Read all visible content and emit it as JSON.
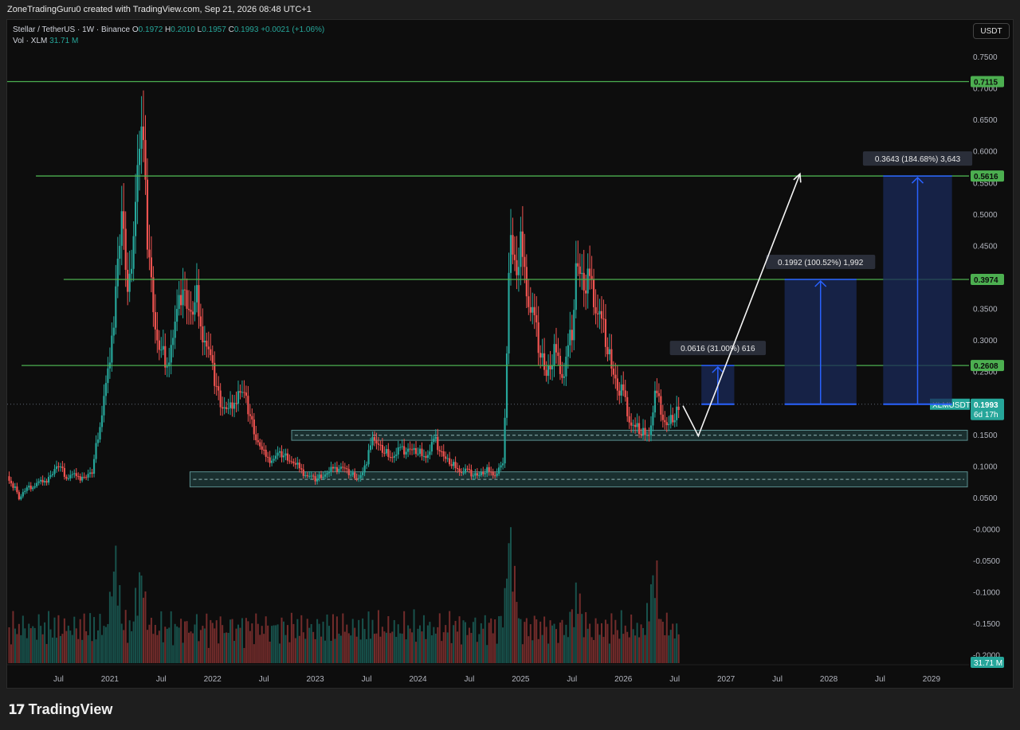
{
  "header": {
    "credit": "ZoneTradingGuru0 created with TradingView.com, Sep 21, 2026 08:48 UTC+1"
  },
  "legend": {
    "symbol": "Stellar / TetherUS · 1W · Binance",
    "open_label": "O",
    "open": "0.1972",
    "high_label": "H",
    "high": "0.2010",
    "low_label": "L",
    "low": "0.1957",
    "close_label": "C",
    "close": "0.1993",
    "change": "+0.0021 (+1.06%)",
    "vol_label": "Vol · XLM",
    "vol_value": "31.71 M"
  },
  "currency_button": "USDT",
  "footer": {
    "brand": "TradingView",
    "brand_icon": "tradingview-logo-icon"
  },
  "colors": {
    "up": "#26a69a",
    "down": "#ef5350",
    "level_line": "#4caf50",
    "level_label_bg": "#4caf50",
    "zone_fill": "#1f3b3b",
    "zone_border": "#5a8f8f",
    "projection_fill": "#1a2a5a",
    "projection_line": "#2962ff",
    "price_label_bg": "#26a69a"
  },
  "chart_data": {
    "type": "candlestick",
    "symbol": "XLMUSDT",
    "interval": "1W",
    "price_axis": {
      "ticks": [
        "0.7500",
        "0.7000",
        "0.6500",
        "0.6000",
        "0.5500",
        "0.5000",
        "0.4500",
        "0.4000",
        "0.3500",
        "0.3000",
        "0.2500",
        "0.2000",
        "0.1500",
        "0.1000",
        "0.0500",
        "-0.0000",
        "-0.0500",
        "-0.1000",
        "-0.1500",
        "-0.2000"
      ],
      "tick_values": [
        0.75,
        0.7,
        0.65,
        0.6,
        0.55,
        0.5,
        0.45,
        0.4,
        0.35,
        0.3,
        0.25,
        0.2,
        0.15,
        0.1,
        0.05,
        0.0,
        -0.05,
        -0.1,
        -0.15,
        -0.2
      ],
      "range": [
        -0.21,
        0.8
      ]
    },
    "time_axis": {
      "labels": [
        "Jul",
        "2021",
        "Jul",
        "2022",
        "Jul",
        "2023",
        "Jul",
        "2024",
        "Jul",
        "2025",
        "Jul",
        "2026",
        "Jul",
        "2027",
        "Jul",
        "2028",
        "Jul",
        "2029"
      ],
      "label_times": [
        2020.5,
        2021.0,
        2021.5,
        2022.0,
        2022.5,
        2023.0,
        2023.5,
        2024.0,
        2024.5,
        2025.0,
        2025.5,
        2026.0,
        2026.5,
        2027.0,
        2027.5,
        2028.0,
        2028.5,
        2029.0
      ],
      "range": [
        2020.0,
        2029.35
      ]
    },
    "horizontal_levels": [
      {
        "price": 0.7115,
        "label": "0.7115"
      },
      {
        "price": 0.5616,
        "label": "0.5616"
      },
      {
        "price": 0.3974,
        "label": "0.3974"
      },
      {
        "price": 0.2608,
        "label": "0.2608"
      }
    ],
    "current_price": {
      "symbol_label": "XLMUSDT",
      "price": 0.1993,
      "label": "0.1993",
      "countdown": "6d 17h"
    },
    "volume_label": "31.71 M",
    "support_zones": [
      {
        "t_start": 2022.77,
        "t_end": 2029.35,
        "top": 0.158,
        "bottom": 0.142
      },
      {
        "t_start": 2021.78,
        "t_end": 2029.35,
        "top": 0.092,
        "bottom": 0.068
      }
    ],
    "projections": [
      {
        "t_start": 2026.76,
        "t_end": 2027.08,
        "base": 0.1993,
        "target": 0.2608,
        "label": "0.0616 (31.00%) 616"
      },
      {
        "t_start": 2027.57,
        "t_end": 2028.27,
        "base": 0.1993,
        "target": 0.3974,
        "label": "0.1992 (100.52%) 1,992"
      },
      {
        "t_start": 2028.53,
        "t_end": 2029.2,
        "base": 0.1993,
        "target": 0.5616,
        "label": "0.3643 (184.68%) 3,643"
      }
    ],
    "path_arrow": [
      {
        "t": 2026.58,
        "p": 0.197
      },
      {
        "t": 2026.73,
        "p": 0.149
      },
      {
        "t": 2027.72,
        "p": 0.565
      }
    ],
    "price_anchors": [
      [
        2020.0,
        0.085
      ],
      [
        2020.08,
        0.065
      ],
      [
        2020.12,
        0.045
      ],
      [
        2020.17,
        0.062
      ],
      [
        2020.25,
        0.07
      ],
      [
        2020.33,
        0.075
      ],
      [
        2020.42,
        0.082
      ],
      [
        2020.5,
        0.1
      ],
      [
        2020.58,
        0.085
      ],
      [
        2020.67,
        0.085
      ],
      [
        2020.75,
        0.08
      ],
      [
        2020.83,
        0.09
      ],
      [
        2020.9,
        0.17
      ],
      [
        2021.0,
        0.26
      ],
      [
        2021.08,
        0.42
      ],
      [
        2021.12,
        0.5
      ],
      [
        2021.18,
        0.35
      ],
      [
        2021.25,
        0.55
      ],
      [
        2021.32,
        0.62
      ],
      [
        2021.37,
        0.45
      ],
      [
        2021.45,
        0.3
      ],
      [
        2021.5,
        0.28
      ],
      [
        2021.55,
        0.27
      ],
      [
        2021.62,
        0.3
      ],
      [
        2021.7,
        0.38
      ],
      [
        2021.8,
        0.34
      ],
      [
        2021.85,
        0.37
      ],
      [
        2021.92,
        0.3
      ],
      [
        2022.0,
        0.25
      ],
      [
        2022.08,
        0.2
      ],
      [
        2022.17,
        0.19
      ],
      [
        2022.25,
        0.22
      ],
      [
        2022.33,
        0.2
      ],
      [
        2022.42,
        0.15
      ],
      [
        2022.5,
        0.12
      ],
      [
        2022.58,
        0.11
      ],
      [
        2022.67,
        0.12
      ],
      [
        2022.75,
        0.115
      ],
      [
        2022.83,
        0.1
      ],
      [
        2022.92,
        0.085
      ],
      [
        2023.0,
        0.08
      ],
      [
        2023.08,
        0.09
      ],
      [
        2023.17,
        0.095
      ],
      [
        2023.25,
        0.1
      ],
      [
        2023.33,
        0.09
      ],
      [
        2023.42,
        0.085
      ],
      [
        2023.5,
        0.1
      ],
      [
        2023.55,
        0.155
      ],
      [
        2023.58,
        0.14
      ],
      [
        2023.67,
        0.125
      ],
      [
        2023.75,
        0.12
      ],
      [
        2023.83,
        0.125
      ],
      [
        2023.92,
        0.13
      ],
      [
        2024.0,
        0.125
      ],
      [
        2024.08,
        0.12
      ],
      [
        2024.17,
        0.14
      ],
      [
        2024.25,
        0.12
      ],
      [
        2024.33,
        0.105
      ],
      [
        2024.42,
        0.095
      ],
      [
        2024.5,
        0.09
      ],
      [
        2024.58,
        0.09
      ],
      [
        2024.67,
        0.095
      ],
      [
        2024.75,
        0.09
      ],
      [
        2024.83,
        0.1
      ],
      [
        2024.87,
        0.32
      ],
      [
        2024.9,
        0.5
      ],
      [
        2024.95,
        0.42
      ],
      [
        2025.0,
        0.45
      ],
      [
        2025.08,
        0.37
      ],
      [
        2025.17,
        0.3
      ],
      [
        2025.25,
        0.26
      ],
      [
        2025.33,
        0.28
      ],
      [
        2025.42,
        0.25
      ],
      [
        2025.5,
        0.32
      ],
      [
        2025.55,
        0.45
      ],
      [
        2025.62,
        0.4
      ],
      [
        2025.7,
        0.38
      ],
      [
        2025.78,
        0.34
      ],
      [
        2025.87,
        0.28
      ],
      [
        2025.95,
        0.23
      ],
      [
        2026.0,
        0.21
      ],
      [
        2026.08,
        0.17
      ],
      [
        2026.17,
        0.16
      ],
      [
        2026.25,
        0.155
      ],
      [
        2026.3,
        0.21
      ],
      [
        2026.35,
        0.2
      ],
      [
        2026.42,
        0.17
      ],
      [
        2026.5,
        0.185
      ],
      [
        2026.55,
        0.1993
      ]
    ],
    "volume_spikes": [
      [
        2021.05,
        0.55
      ],
      [
        2021.3,
        0.45
      ],
      [
        2024.9,
        0.9
      ],
      [
        2025.55,
        0.25
      ],
      [
        2026.3,
        0.45
      ]
    ]
  }
}
